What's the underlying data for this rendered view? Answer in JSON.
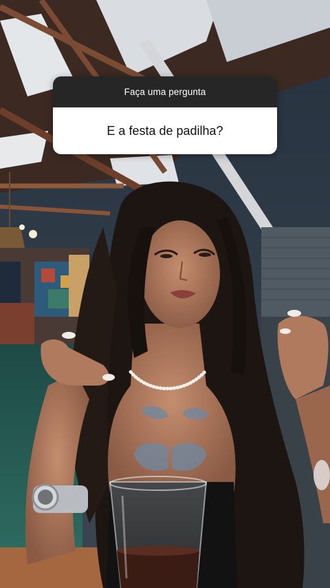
{
  "question_sticker": {
    "prompt": "Faça uma pergunta",
    "answer": "E a festa de padilha?"
  },
  "colors": {
    "sticker_header": "#262626",
    "sticker_body": "#ffffff",
    "ceiling": "#5a3a2a",
    "wall": "#2c3a4a"
  }
}
